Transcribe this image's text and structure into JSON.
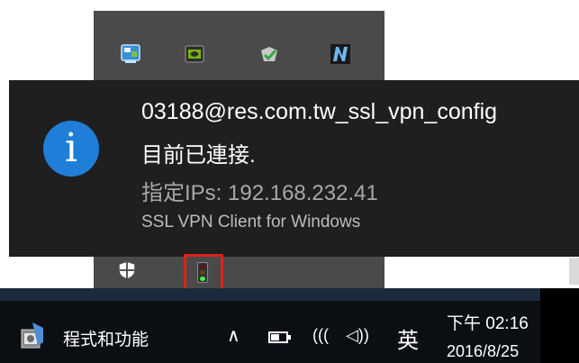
{
  "notification": {
    "title": "03188@res.com.tw_ssl_vpn_config",
    "line1": "目前已連接.",
    "line2": "指定IPs: 192.168.232.41",
    "source": "SSL VPN Client for Windows",
    "icon": "info-icon",
    "icon_glyph": "i"
  },
  "tray_overflow": {
    "icons": [
      "network-config-icon",
      "nvidia-icon",
      "security-check-icon",
      "n-app-icon",
      "shield-icon",
      "vpn-traffic-light-icon"
    ],
    "highlighted": "vpn-traffic-light-icon",
    "highlight_color": "#e0201c"
  },
  "taskbar": {
    "app_label": "程式和功能",
    "chevron": "∧",
    "wifi_glyph": "(((",
    "volume_glyph": "◁))",
    "ime": "英",
    "time": "下午 02:16",
    "date": "2016/8/25"
  },
  "colors": {
    "toast_bg": "#1f1f1f",
    "flyout_bg": "#4a4a4a",
    "info_blue": "#1f7fd8",
    "taskbar_bg": "#0b0f14"
  }
}
